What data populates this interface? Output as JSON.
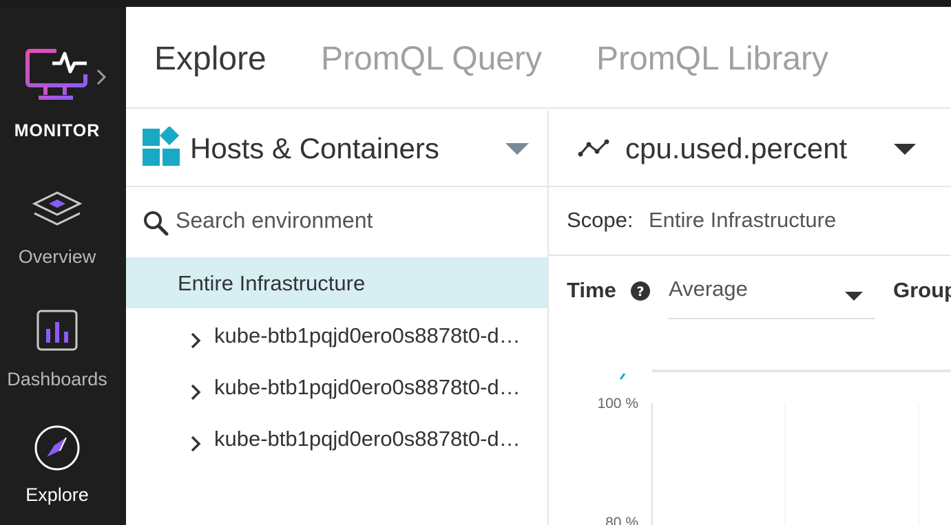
{
  "app": {
    "brand": "MONITOR"
  },
  "rail": {
    "items": [
      {
        "label": "Overview",
        "icon": "layers-icon"
      },
      {
        "label": "Dashboards",
        "icon": "bar-chart-icon"
      },
      {
        "label": "Explore",
        "icon": "compass-icon",
        "active": true
      }
    ]
  },
  "tabs": [
    {
      "label": "Explore",
      "active": true
    },
    {
      "label": "PromQL Query"
    },
    {
      "label": "PromQL Library"
    }
  ],
  "source_selector": {
    "label": "Hosts & Containers",
    "icon": "hosts-containers-icon"
  },
  "metric_selector": {
    "label": "cpu.used.percent",
    "icon": "metric-line-icon"
  },
  "search": {
    "placeholder": "Search environment",
    "value": ""
  },
  "scope": {
    "label": "Scope:",
    "value": "Entire Infrastructure"
  },
  "tree": {
    "root": "Entire Infrastructure",
    "nodes": [
      "kube-btb1pqjd0ero0s8878t0-d…",
      "kube-btb1pqjd0ero0s8878t0-d…",
      "kube-btb1pqjd0ero0s8878t0-d…"
    ]
  },
  "controls": {
    "time_label": "Time",
    "time_aggregation": "Average",
    "group_label": "Group"
  },
  "chart_data": {
    "type": "line",
    "yticks": [
      "100 %",
      "80 %"
    ],
    "series": []
  },
  "colors": {
    "rail_bg": "#1e1e1e",
    "accent_purple": "#a855f7",
    "accent_pink": "#e44fb0",
    "selection_bg": "#d7eef3",
    "logo_teal": "#19a9c4"
  }
}
